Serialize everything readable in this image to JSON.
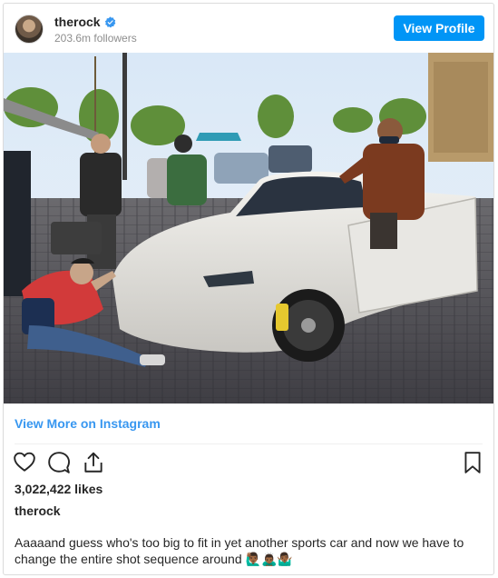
{
  "post": {
    "username": "therock",
    "followers": "203.6m followers",
    "view_profile_label": "View Profile",
    "view_more_label": "View More on Instagram",
    "likes": "3,022,422 likes",
    "caption_username": "therock",
    "caption_text": "Aaaaand guess who's too big to fit in yet another sports car and now we have to change the entire shot sequence around",
    "caption_emoji": "🙋🏾‍♂️🙇🏾‍♂️🤷🏾‍♂️"
  },
  "photo": {
    "alt": "Film crew on set with a white sports car; a man in a leather jacket stands at the open car door while a crew member in a red jacket sits on the cobblestones"
  },
  "icons": {
    "verified": "verified-badge-icon",
    "like": "heart-icon",
    "comment": "comment-icon",
    "share": "share-icon",
    "save": "bookmark-icon"
  },
  "colors": {
    "accent": "#0095f6",
    "link": "#3897f0",
    "text": "#262626",
    "muted": "#8e8e8e"
  }
}
